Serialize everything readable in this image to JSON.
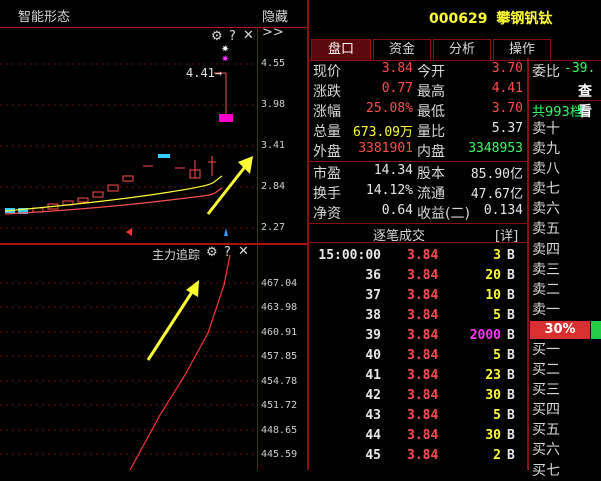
{
  "chart_panel": {
    "title": "智能形态",
    "hide_label": "隐藏>>",
    "price_ticks": [
      "4.55",
      "3.98",
      "3.41",
      "2.84",
      "2.27"
    ],
    "price_tag": "4.41→",
    "lower_title": "主力追踪",
    "lower_ticks": [
      "467.04",
      "463.98",
      "460.91",
      "457.85",
      "454.78",
      "451.72",
      "448.65",
      "445.59"
    ],
    "icons": {
      "settings": "gear-icon",
      "help": "question-icon",
      "close": "close-icon"
    }
  },
  "stock": {
    "code": "000629",
    "name": "攀钢钒钛"
  },
  "tabs": [
    "盘口",
    "资金",
    "分析",
    "操作"
  ],
  "quote": {
    "rows": [
      {
        "l1": "现价",
        "v1": "3.84",
        "c1": "red",
        "l2": "今开",
        "v2": "3.70",
        "c2": "red"
      },
      {
        "l1": "涨跌",
        "v1": "0.77",
        "c1": "red",
        "l2": "最高",
        "v2": "4.41",
        "c2": "red"
      },
      {
        "l1": "涨幅",
        "v1": "25.08%",
        "c1": "red",
        "l2": "最低",
        "v2": "3.70",
        "c2": "red"
      },
      {
        "l1": "总量",
        "v1": "673.09万",
        "c1": "yel",
        "l2": "量比",
        "v2": "5.37",
        "c2": "wht"
      },
      {
        "l1": "外盘",
        "v1": "3381901",
        "c1": "red",
        "l2": "内盘",
        "v2": "3348953",
        "c2": "grn"
      }
    ],
    "rows2": [
      {
        "l1": "市盈",
        "v1": "14.34",
        "l2": "股本",
        "v2": "85.90亿"
      },
      {
        "l1": "换手",
        "v1": "14.12%",
        "l2": "流通",
        "v2": "47.67亿"
      },
      {
        "l1": "净资",
        "v1": "0.64",
        "l2": "收益(二)",
        "v2": "0.134"
      }
    ]
  },
  "ticks_header": {
    "title": "逐笔成交",
    "detail": "[详]"
  },
  "trades": [
    {
      "t": "15:00:00",
      "p": "3.84",
      "v": "3",
      "bs": "B",
      "vc": "yel"
    },
    {
      "t": "36",
      "p": "3.84",
      "v": "20",
      "bs": "B",
      "vc": "yel"
    },
    {
      "t": "37",
      "p": "3.84",
      "v": "10",
      "bs": "B",
      "vc": "yel"
    },
    {
      "t": "38",
      "p": "3.84",
      "v": "5",
      "bs": "B",
      "vc": "yel"
    },
    {
      "t": "39",
      "p": "3.84",
      "v": "2000",
      "bs": "B",
      "vc": "mag"
    },
    {
      "t": "40",
      "p": "3.84",
      "v": "5",
      "bs": "B",
      "vc": "yel"
    },
    {
      "t": "41",
      "p": "3.84",
      "v": "23",
      "bs": "B",
      "vc": "yel"
    },
    {
      "t": "42",
      "p": "3.84",
      "v": "30",
      "bs": "B",
      "vc": "yel"
    },
    {
      "t": "43",
      "p": "3.84",
      "v": "5",
      "bs": "B",
      "vc": "yel"
    },
    {
      "t": "44",
      "p": "3.84",
      "v": "30",
      "bs": "B",
      "vc": "yel"
    },
    {
      "t": "45",
      "p": "3.84",
      "v": "2",
      "bs": "B",
      "vc": "yel"
    }
  ],
  "orderbook": {
    "weibi_label": "委比",
    "weibi_value": "-39.",
    "view_label": "查看",
    "levels_label": "共993档",
    "sell": [
      "卖十",
      "卖九",
      "卖八",
      "卖七",
      "卖六",
      "卖五",
      "卖四",
      "卖三",
      "卖二",
      "卖一"
    ],
    "ratio": "30%",
    "buy": [
      "买一",
      "买二",
      "买三",
      "买四",
      "买五",
      "买六",
      "买七"
    ]
  },
  "colors": {
    "accent_red": "#ff4d4d",
    "border": "#8c1010",
    "yellow": "#ffff33",
    "green": "#33ff66",
    "magenta": "#ff33ff",
    "cyan": "#33ccff"
  }
}
